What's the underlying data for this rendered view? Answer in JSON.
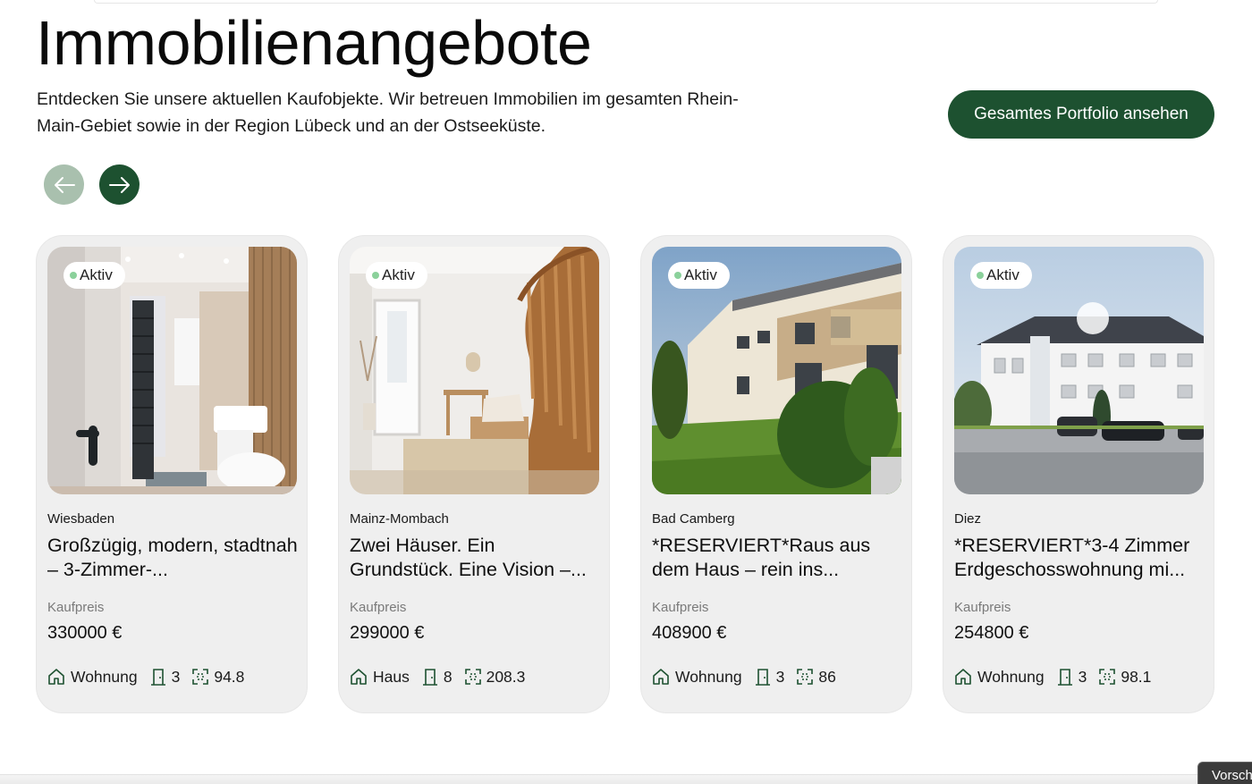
{
  "header": {
    "title": "Immobilienangebote",
    "intro": "Entdecken Sie unsere aktuellen Kaufobjekte. Wir betreuen Immobilien im gesamten Rhein-Main-Gebiet sowie in der Region Lübeck und an der Ostseeküste.",
    "portfolio_button": "Gesamtes Portfolio ansehen"
  },
  "carousel": {
    "prev_icon": "arrow-left-icon",
    "next_icon": "arrow-right-icon"
  },
  "colors": {
    "brand_green": "#1d5130",
    "brand_green_disabled": "#a9c0ae",
    "status_dot": "#8bd19b",
    "card_background": "#efefef"
  },
  "listings": [
    {
      "status": "Aktiv",
      "city": "Wiesbaden",
      "title": "Großzügig, modern, stadtnah – 3-Zimmer-...",
      "price_label": "Kaufpreis",
      "price": "330000 €",
      "type": "Wohnung",
      "rooms": "3",
      "area": "94.8",
      "photo": "bathroom-photo"
    },
    {
      "status": "Aktiv",
      "city": "Mainz-Mombach",
      "title": "Zwei Häuser. Ein Grundstück. Eine Vision –...",
      "price_label": "Kaufpreis",
      "price": "299000 €",
      "type": "Haus",
      "rooms": "8",
      "area": "208.3",
      "photo": "staircase-hallway-photo"
    },
    {
      "status": "Aktiv",
      "city": "Bad Camberg",
      "title": "*RESERVIERT*Raus aus dem Haus – rein ins...",
      "price_label": "Kaufpreis",
      "price": "408900 €",
      "type": "Wohnung",
      "rooms": "3",
      "area": "86",
      "photo": "apartment-building-garden-photo"
    },
    {
      "status": "Aktiv",
      "city": "Diez",
      "title": "*RESERVIERT*3-4 Zimmer Erdgeschosswohnung mi...",
      "price_label": "Kaufpreis",
      "price": "254800 €",
      "type": "Wohnung",
      "rooms": "3",
      "area": "98.1",
      "photo": "white-apartment-house-photo"
    }
  ],
  "footer": {
    "preview_tab": "Vorsch"
  }
}
